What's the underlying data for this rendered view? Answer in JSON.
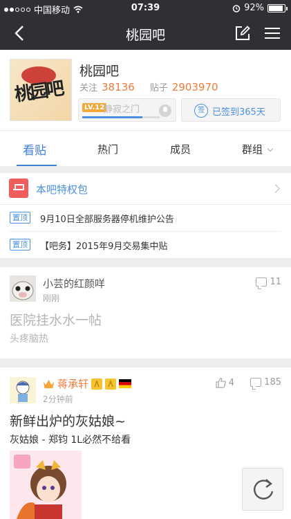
{
  "status_bar": {
    "carrier": "中国移动",
    "time": "07:39",
    "battery_text": "92%",
    "battery_level": 0.92
  },
  "nav": {
    "title": "桃园吧",
    "back_icon": "back-chevron-icon",
    "edit_icon": "compose-icon",
    "menu_icon": "hamburger-menu-icon"
  },
  "forum": {
    "name": "桃园吧",
    "follow_label": "关注",
    "follow_count": "38136",
    "posts_label": "贴子",
    "posts_count": "2903970",
    "level_badge": "LV.12",
    "level_name": "静寂之门",
    "level_progress": 0.78,
    "signin_icon_text": "签",
    "signin_text": "已签到365天",
    "logo_text": "桃园吧"
  },
  "tabs": [
    {
      "label": "看贴"
    },
    {
      "label": "热门"
    },
    {
      "label": "成员"
    },
    {
      "label": "群组"
    }
  ],
  "privilege": {
    "label": "本吧特权包"
  },
  "top_posts": [
    {
      "badge": "置顶",
      "title": "9月10日全部服务器停机维护公告"
    },
    {
      "badge": "置顶",
      "title": "【吧务】2015年9月交易集中贴"
    }
  ],
  "posts": [
    {
      "user": "小芸的红颜咩",
      "time": "刚刚",
      "title": "医院挂水水一帖",
      "body": "头疼脑热",
      "comments": "11"
    },
    {
      "user": "蒋承轩",
      "time": "2分钟前",
      "title": "新鲜出炉的灰姑娘~",
      "body": "灰姑娘 - 郑钧 1L必然不给看",
      "likes": "4",
      "comments": "185"
    }
  ],
  "colors": {
    "nav_bg": "#2f2f35",
    "accent_blue": "#3f7ed8",
    "count_orange": "#f07a3a",
    "username_orange": "#f07a3a",
    "privilege_red": "#f25c5c"
  }
}
